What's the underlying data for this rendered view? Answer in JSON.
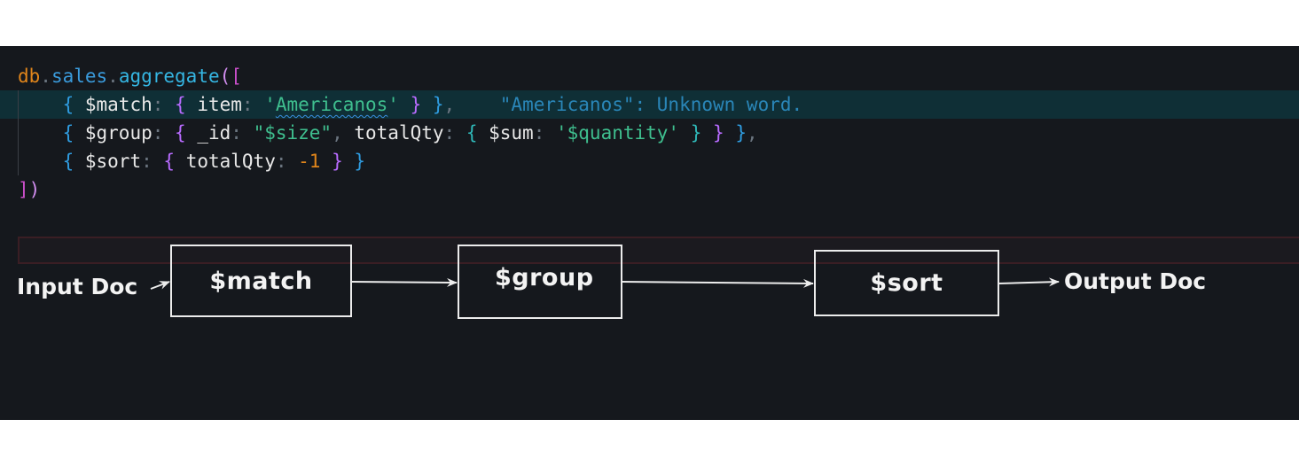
{
  "editor": {
    "line1": {
      "db": "db",
      "dot1": ".",
      "sales": "sales",
      "dot2": ".",
      "fn": "aggregate",
      "open": "([",
      "open_paren": "(",
      "open_bracket": "["
    },
    "line2": {
      "brace_open": "{ ",
      "key": "$match",
      "colon": ": ",
      "inner_open": "{ ",
      "field": "item",
      "colon2": ": ",
      "str_q1": "'",
      "value": "Americanos",
      "str_q2": "'",
      "inner_close": " }",
      "brace_close": " }",
      "comma": ",",
      "diagnostic": "\"Americanos\": Unknown word."
    },
    "line3": {
      "brace_open": "{ ",
      "key": "$group",
      "colon": ": ",
      "inner_open": "{ ",
      "id_key": "_id",
      "colon2": ": ",
      "id_val": "\"$size\"",
      "comma1": ", ",
      "total_key": "totalQty",
      "colon3": ": ",
      "sum_open": "{ ",
      "sum_key": "$sum",
      "colon4": ": ",
      "sum_val": "'$quantity'",
      "sum_close": " }",
      "inner_close": " }",
      "brace_close": " }",
      "comma2": ","
    },
    "line4": {
      "brace_open": "{ ",
      "key": "$sort",
      "colon": ": ",
      "inner_open": "{ ",
      "field": "totalQty",
      "colon2": ": ",
      "value": "-1",
      "inner_close": " }",
      "brace_close": " }"
    },
    "line5": {
      "close_bracket": "]",
      "close_paren": ")"
    }
  },
  "diagram": {
    "input_label": "Input Doc",
    "stages": [
      "$match",
      "$group",
      "$sort"
    ],
    "output_label": "Output Doc"
  },
  "colors": {
    "background": "#15181d",
    "page": "#ffffff",
    "active_line": "#0f2f36",
    "string": "#3fbf8f",
    "number": "#e0851b",
    "diagram_stroke": "#ececec"
  }
}
